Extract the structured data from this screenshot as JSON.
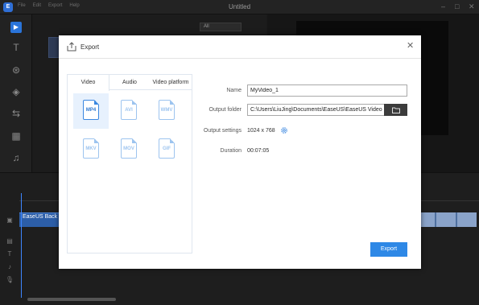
{
  "window": {
    "title": "Untitled",
    "menu": [
      "File",
      "Edit",
      "Export",
      "Help"
    ]
  },
  "background": {
    "media_dropdown": "All",
    "clip_label": "EaseUS Back"
  },
  "dialog": {
    "title": "Export",
    "tabs": [
      "Video",
      "Audio",
      "Video platform"
    ],
    "active_tab": "Video",
    "formats": [
      "MP4",
      "AVI",
      "WMV",
      "MKV",
      "MOV",
      "GIF"
    ],
    "selected_format": "MP4",
    "fields": {
      "name_label": "Name",
      "name_value": "MyVideo_1",
      "folder_label": "Output folder",
      "folder_value": "C:\\Users\\LiuJing\\Documents\\EaseUS\\EaseUS Video E",
      "settings_label": "Output settings",
      "settings_value": "1024 x 768",
      "duration_label": "Duration",
      "duration_value": "00:07:05"
    },
    "export_button": "Export"
  },
  "colors": {
    "accent": "#2e88e6",
    "clip": "#2c5ea8",
    "format_icon": "#9dc4ef"
  }
}
